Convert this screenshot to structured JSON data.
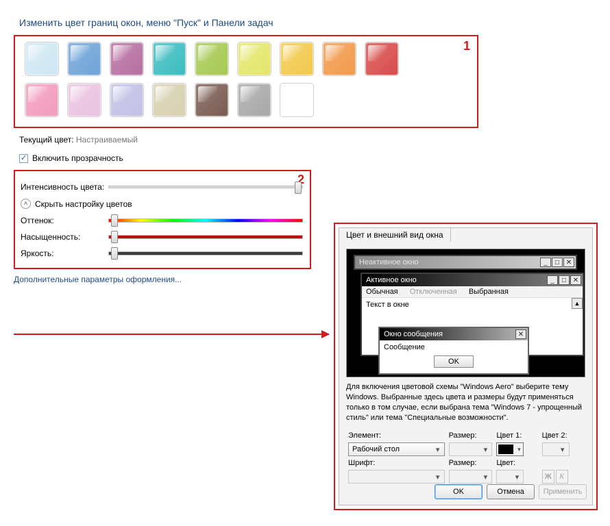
{
  "title": "Изменить цвет границ окон, меню \"Пуск\" и Панели задач",
  "annotations": {
    "box1": "1",
    "box2": "2"
  },
  "swatches_row1": [
    "#cfe7f3",
    "#6fa3d8",
    "#b66fa1",
    "#3bbdc0",
    "#a6c951",
    "#e3e66a",
    "#f2c94c",
    "#f2994a",
    "#d84b4b"
  ],
  "swatches_row2": [
    "#f29bbd",
    "#eac2e0",
    "#c2c0e6",
    "#d7d0b0",
    "#7a5b52",
    "#a8a8a8",
    "#ffffff"
  ],
  "current_color_label": "Текущий цвет:",
  "current_color_value": "Настраиваемый",
  "transparency_checkbox": "Включить прозрачность",
  "intensity_label": "Интенсивность цвета:",
  "collapse_label": "Скрыть настройку цветов",
  "hue_label": "Оттенок:",
  "sat_label": "Насыщенность:",
  "bri_label": "Яркость:",
  "advanced_link": "Дополнительные параметры оформления...",
  "dialog": {
    "tab": "Цвет и внешний вид окна",
    "inactive_title": "Неактивное окно",
    "active_title": "Активное окно",
    "menu": {
      "normal": "Обычная",
      "disabled": "Отключенная",
      "selected": "Выбранная"
    },
    "body_text": "Текст в окне",
    "msg_title": "Окно сообщения",
    "msg_body": "Сообщение",
    "msg_ok": "OK",
    "hint": "Для включения цветовой схемы \"Windows Aero\" выберите тему Windows.  Выбранные здесь цвета и размеры будут применяться только в том случае, если выбрана тема \"Windows 7 - упрощенный стиль\" или тема \"Специальные возможности\".",
    "element_label": "Элемент:",
    "element_value": "Рабочий стол",
    "size_label": "Размер:",
    "color1_label": "Цвет 1:",
    "color2_label": "Цвет 2:",
    "font_label": "Шрифт:",
    "font_size_label": "Размер:",
    "font_color_label": "Цвет:",
    "bold": "Ж",
    "italic": "К",
    "ok": "OK",
    "cancel": "Отмена",
    "apply": "Применить"
  }
}
